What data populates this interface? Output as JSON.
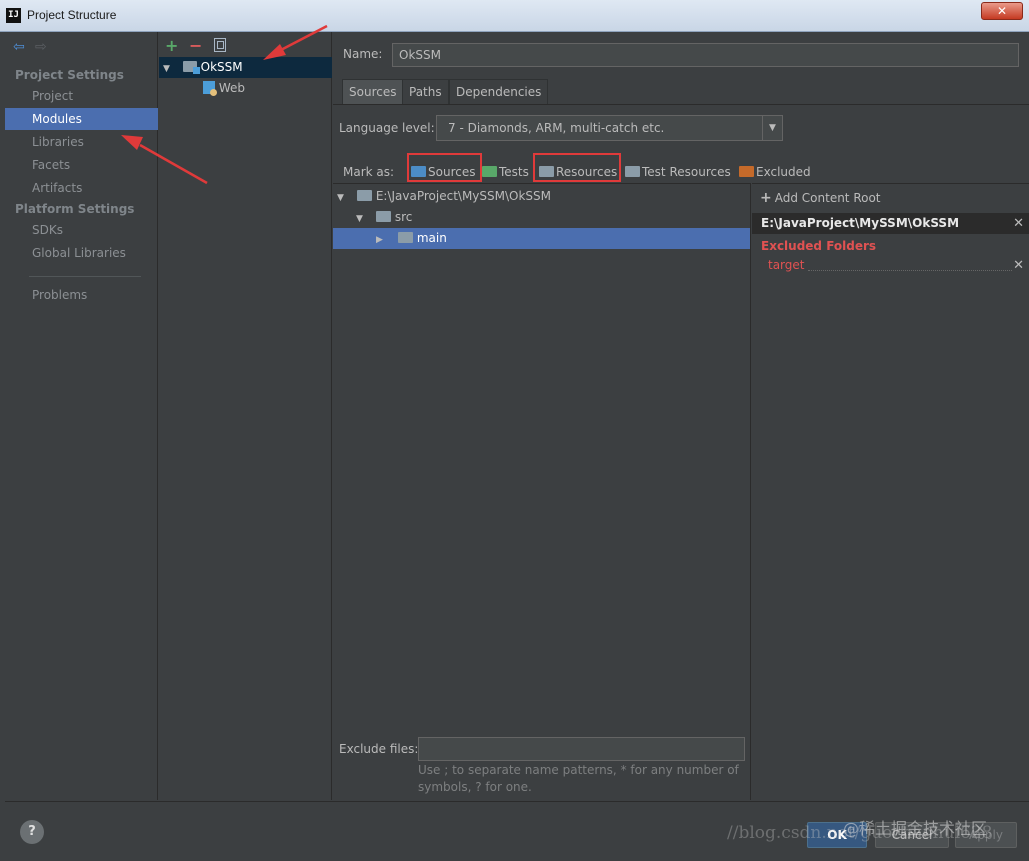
{
  "window": {
    "title": "Project Structure",
    "app_icon_text": "IJ"
  },
  "nav": {
    "sections": [
      {
        "title": "Project Settings",
        "items": [
          "Project",
          "Modules",
          "Libraries",
          "Facets",
          "Artifacts"
        ]
      },
      {
        "title": "Platform Settings",
        "items": [
          "SDKs",
          "Global Libraries"
        ]
      }
    ],
    "extra": "Problems",
    "selected": "Modules"
  },
  "modules": {
    "tree": [
      {
        "label": "OkSSM",
        "expanded": true,
        "selected": true
      },
      {
        "label": "Web",
        "child": true
      }
    ]
  },
  "main": {
    "name_label": "Name:",
    "name_value": "OkSSM",
    "tabs": [
      "Sources",
      "Paths",
      "Dependencies"
    ],
    "active_tab": "Sources",
    "language_label": "Language level:",
    "language_value": "7 - Diamonds, ARM, multi-catch etc.",
    "mark_as_label": "Mark as:",
    "mark_as": [
      {
        "label": "Sources",
        "color": "#4c8dc7"
      },
      {
        "label": "Tests",
        "color": "#59a869"
      },
      {
        "label": "Resources",
        "color": "#8b9ca8"
      },
      {
        "label": "Test Resources",
        "color": "#8b9ca8"
      },
      {
        "label": "Excluded",
        "color": "#c56a2a"
      }
    ],
    "tree": [
      {
        "label": "E:\\JavaProject\\MySSM\\OkSSM",
        "level": 0,
        "expanded": true
      },
      {
        "label": "src",
        "level": 1,
        "expanded": true
      },
      {
        "label": "main",
        "level": 2,
        "expanded": false,
        "selected": true
      }
    ],
    "exclude_label": "Exclude files:",
    "exclude_value": "",
    "exclude_hint": "Use ; to separate name patterns, * for any number of symbols, ? for one."
  },
  "content_root": {
    "add_label": "Add Content Root",
    "root_path": "E:\\JavaProject\\MySSM\\OkSSM",
    "excluded_title": "Excluded Folders",
    "excluded_items": [
      "target"
    ]
  },
  "buttons": {
    "ok": "OK",
    "cancel": "Cancel",
    "apply": "Apply",
    "help": "?"
  },
  "watermark": {
    "url": "//blog.csdn.net/guozhaohui628",
    "brand": "@稀土掘金技术社区"
  },
  "colors": {
    "selection": "#4b6eaf",
    "annotation": "#e03a3a",
    "excluded": "#e05252"
  }
}
